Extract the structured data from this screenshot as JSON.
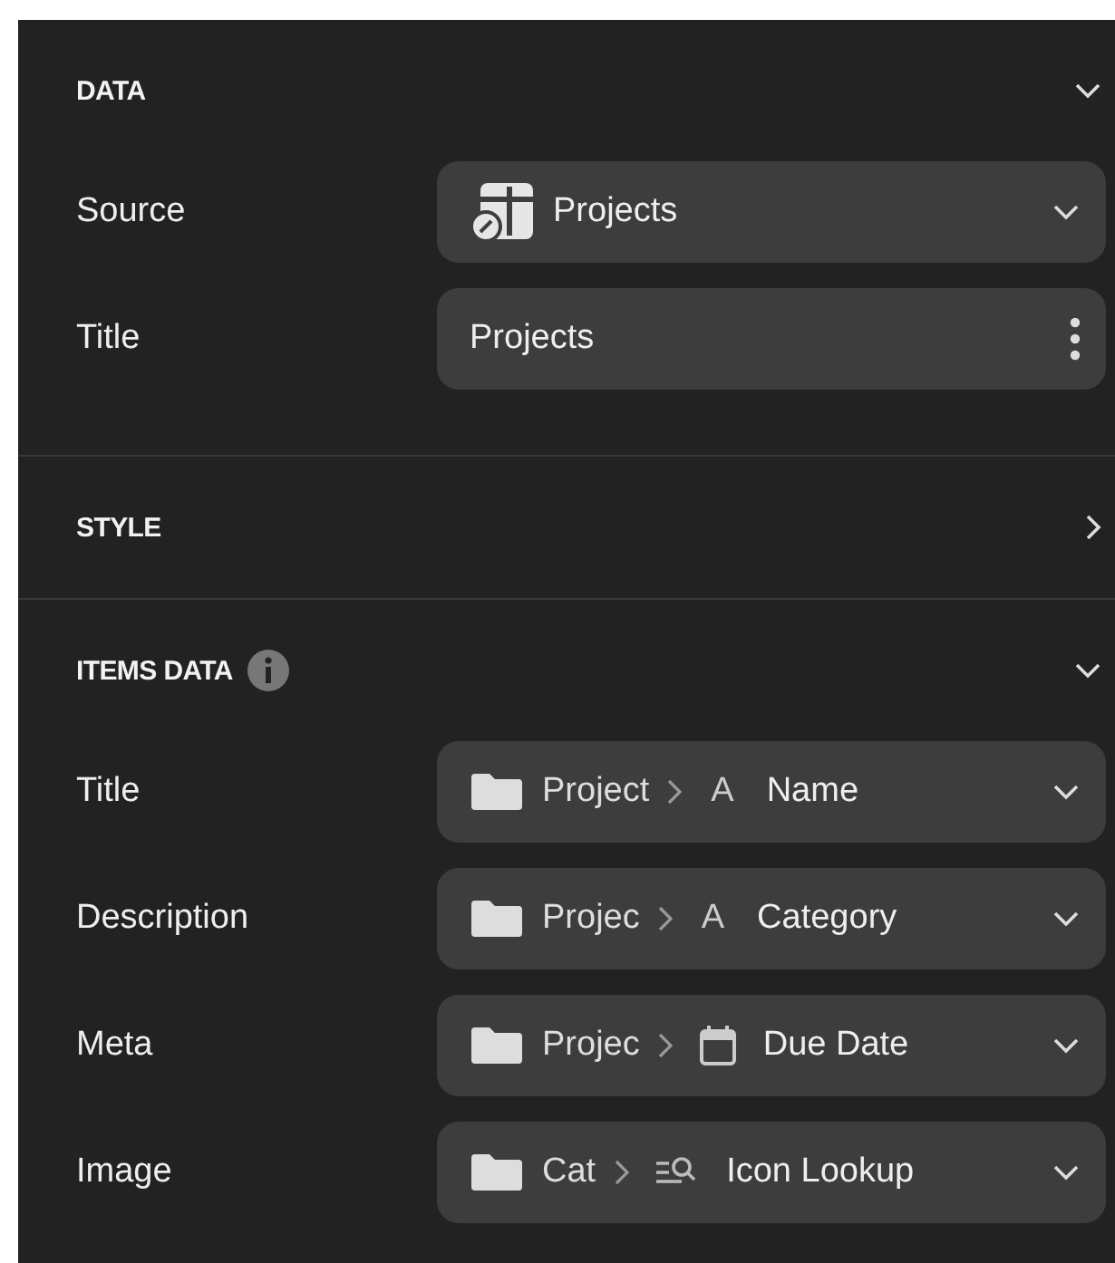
{
  "sections": [
    {
      "title": "DATA",
      "expanded": true,
      "info": false,
      "rows": [
        {
          "kind": "source",
          "label": "Source",
          "value": "Projects"
        },
        {
          "kind": "text",
          "label": "Title",
          "value": "Projects"
        }
      ]
    },
    {
      "title": "STYLE",
      "expanded": false,
      "info": false
    },
    {
      "title": "ITEMS DATA",
      "expanded": true,
      "info": true,
      "rows": [
        {
          "kind": "path",
          "label": "Title",
          "source": "Project",
          "type_icon": {
            "kind": "text",
            "glyph": "A"
          },
          "field": "Name"
        },
        {
          "kind": "path",
          "label": "Description",
          "source": "Projec",
          "type_icon": {
            "kind": "text",
            "glyph": "A"
          },
          "field": "Category"
        },
        {
          "kind": "path",
          "label": "Meta",
          "source": "Projec",
          "type_icon": {
            "kind": "date"
          },
          "field": "Due Date"
        },
        {
          "kind": "path",
          "label": "Image",
          "source": "Cat",
          "type_icon": {
            "kind": "lookup"
          },
          "field": "Icon Lookup"
        }
      ]
    }
  ]
}
